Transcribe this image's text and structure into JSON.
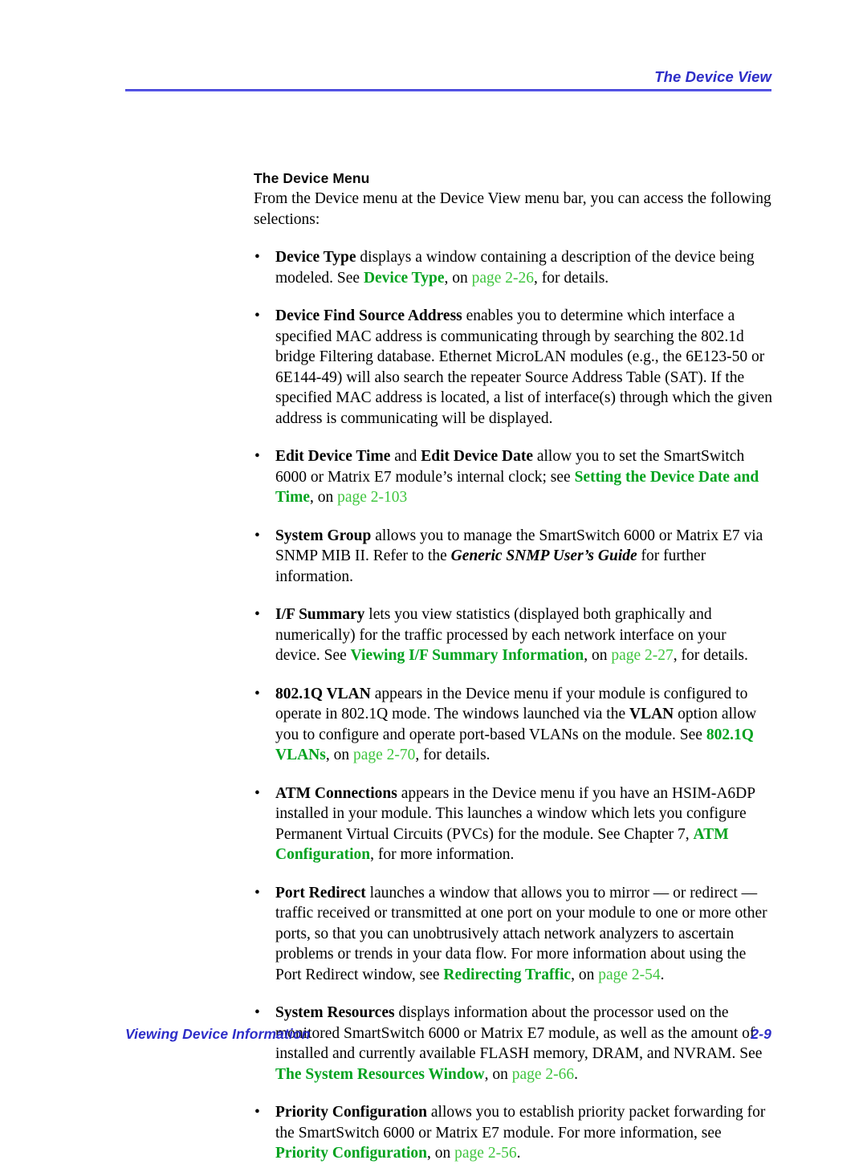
{
  "header": {
    "running_head": "The Device View"
  },
  "footer": {
    "running_foot": "Viewing Device Information",
    "page_number": "2-9"
  },
  "colors": {
    "header_blue": "#2d2dc8",
    "rule_blue": "#5050e0",
    "link_green": "#00a21e",
    "page_ref_green": "#3fc53f",
    "body_text": "#000000"
  },
  "section": {
    "title": "The Device Menu",
    "intro": "From the Device menu at the Device View menu bar, you can access the following selections:"
  },
  "bullets": [
    {
      "id": "device-type",
      "marker": "•",
      "term": "Device Type",
      "parts": [
        {
          "type": "bold",
          "text": "Device Type"
        },
        {
          "type": "plain",
          "text": " displays a window containing a description of the device being modeled. See "
        },
        {
          "type": "link",
          "text": "Device Type"
        },
        {
          "type": "plain",
          "text": ", on "
        },
        {
          "type": "page",
          "text": "page 2-26"
        },
        {
          "type": "plain",
          "text": ", for details."
        }
      ]
    },
    {
      "id": "device-find-source-address",
      "marker": "•",
      "term": "Device Find Source Address",
      "parts": [
        {
          "type": "bold",
          "text": "Device Find Source Address"
        },
        {
          "type": "plain",
          "text": " enables you to determine which interface a specified MAC address is communicating through by searching the 802.1d bridge Filtering database. Ethernet MicroLAN modules (e.g., the 6E123-50 or 6E144-49) will also search the repeater Source Address Table (SAT). If the specified MAC address is located, a list of interface(s) through which the given address is communicating will be displayed."
        }
      ]
    },
    {
      "id": "edit-device-time-date",
      "marker": "•",
      "term": "Edit Device Time and Edit Device Date",
      "parts": [
        {
          "type": "bold",
          "text": "Edit Device Time"
        },
        {
          "type": "plain",
          "text": " and "
        },
        {
          "type": "bold",
          "text": "Edit Device Date"
        },
        {
          "type": "plain",
          "text": " allow you to set the SmartSwitch 6000 or Matrix E7 module’s internal clock; see "
        },
        {
          "type": "link",
          "text": "Setting the Device Date and Time"
        },
        {
          "type": "plain",
          "text": ", on "
        },
        {
          "type": "page",
          "text": "page 2-103"
        }
      ]
    },
    {
      "id": "system-group",
      "marker": "•",
      "term": "System Group",
      "parts": [
        {
          "type": "bold",
          "text": "System Group"
        },
        {
          "type": "plain",
          "text": " allows you to manage the SmartSwitch 6000 or Matrix E7 via SNMP MIB II. Refer to the "
        },
        {
          "type": "bolditalic",
          "text": "Generic SNMP User’s Guide"
        },
        {
          "type": "plain",
          "text": " for further information."
        }
      ]
    },
    {
      "id": "if-summary",
      "marker": "•",
      "term": "I/F Summary",
      "parts": [
        {
          "type": "bold",
          "text": "I/F Summary"
        },
        {
          "type": "plain",
          "text": " lets you view statistics (displayed both graphically and numerically) for the traffic processed by each network interface on your device. See "
        },
        {
          "type": "link",
          "text": "Viewing I/F Summary Information"
        },
        {
          "type": "plain",
          "text": ", on "
        },
        {
          "type": "page",
          "text": "page 2-27"
        },
        {
          "type": "plain",
          "text": ", for details."
        }
      ]
    },
    {
      "id": "802-1q-vlan",
      "marker": "•",
      "term": "802.1Q VLAN",
      "parts": [
        {
          "type": "bold",
          "text": "802.1Q VLAN"
        },
        {
          "type": "plain",
          "text": " appears in the Device menu if your module is configured to operate in 802.1Q mode. The windows launched via the "
        },
        {
          "type": "bold",
          "text": "VLAN"
        },
        {
          "type": "plain",
          "text": " option allow you to configure and operate port-based VLANs on the module. See "
        },
        {
          "type": "link",
          "text": "802.1Q VLANs"
        },
        {
          "type": "plain",
          "text": ", on "
        },
        {
          "type": "page",
          "text": "page 2-70"
        },
        {
          "type": "plain",
          "text": ", for details."
        }
      ]
    },
    {
      "id": "atm-connections",
      "marker": "•",
      "term": "ATM Connections",
      "parts": [
        {
          "type": "bold",
          "text": "ATM Connections"
        },
        {
          "type": "plain",
          "text": " appears in the Device menu if you have an HSIM-A6DP installed in your module. This launches a window which lets you configure Permanent Virtual Circuits (PVCs) for the module. See Chapter 7, "
        },
        {
          "type": "link",
          "text": "ATM Configuration"
        },
        {
          "type": "plain",
          "text": ", for more information."
        }
      ]
    },
    {
      "id": "port-redirect",
      "marker": "•",
      "term": "Port Redirect",
      "parts": [
        {
          "type": "bold",
          "text": "Port Redirect"
        },
        {
          "type": "plain",
          "text": " launches a window that allows you to mirror — or redirect — traffic received or transmitted at one port on your module to one or more other ports, so that you can unobtrusively attach network analyzers to ascertain problems or trends in your data flow. For more information about using the Port Redirect window, see "
        },
        {
          "type": "link",
          "text": "Redirecting Traffic"
        },
        {
          "type": "plain",
          "text": ", on "
        },
        {
          "type": "page",
          "text": "page 2-54"
        },
        {
          "type": "plain",
          "text": "."
        }
      ]
    },
    {
      "id": "system-resources",
      "marker": "•",
      "term": "System Resources",
      "parts": [
        {
          "type": "bold",
          "text": "System Resources"
        },
        {
          "type": "plain",
          "text": " displays information about the processor used on the monitored SmartSwitch 6000 or Matrix E7 module, as well as the amount of installed and currently available FLASH memory, DRAM, and NVRAM. See "
        },
        {
          "type": "link",
          "text": "The System Resources Window"
        },
        {
          "type": "plain",
          "text": ", on "
        },
        {
          "type": "page",
          "text": "page 2-66"
        },
        {
          "type": "plain",
          "text": "."
        }
      ]
    },
    {
      "id": "priority-configuration",
      "marker": "•",
      "term": "Priority Configuration",
      "parts": [
        {
          "type": "bold",
          "text": "Priority Configuration"
        },
        {
          "type": "plain",
          "text": " allows you to establish priority packet forwarding for the SmartSwitch 6000 or Matrix E7 module. For more information, see "
        },
        {
          "type": "link",
          "text": "Priority Configuration"
        },
        {
          "type": "plain",
          "text": ", on "
        },
        {
          "type": "page",
          "text": "page 2-56"
        },
        {
          "type": "plain",
          "text": "."
        }
      ]
    }
  ]
}
